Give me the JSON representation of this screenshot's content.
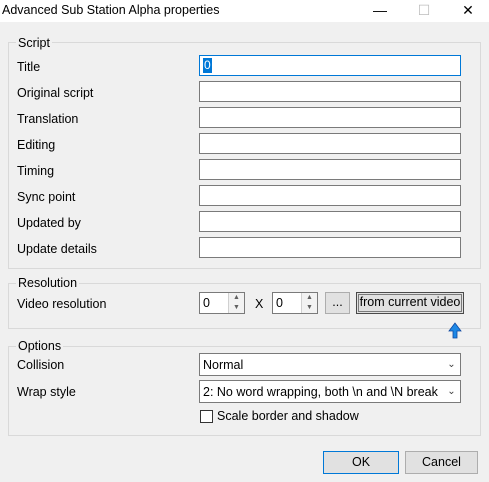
{
  "window": {
    "title": "Advanced Sub Station Alpha properties",
    "minimize_glyph": "—",
    "maximize_glyph": "☐",
    "close_glyph": "✕"
  },
  "script": {
    "legend": "Script",
    "fields": [
      {
        "label": "Title",
        "value": "0"
      },
      {
        "label": "Original script",
        "value": ""
      },
      {
        "label": "Translation",
        "value": ""
      },
      {
        "label": "Editing",
        "value": ""
      },
      {
        "label": "Timing",
        "value": ""
      },
      {
        "label": "Sync point",
        "value": ""
      },
      {
        "label": "Updated by",
        "value": ""
      },
      {
        "label": "Update details",
        "value": ""
      }
    ]
  },
  "resolution": {
    "legend": "Resolution",
    "label": "Video resolution",
    "width": "0",
    "separator": "X",
    "height": "0",
    "browse_label": "...",
    "from_video_label": "from current video"
  },
  "options": {
    "legend": "Options",
    "collision_label": "Collision",
    "collision_value": "Normal",
    "wrap_label": "Wrap style",
    "wrap_value": "2: No word wrapping, both \\n and \\N break",
    "scale_label": "Scale border and shadow",
    "scale_checked": false
  },
  "footer": {
    "ok_label": "OK",
    "cancel_label": "Cancel"
  },
  "colors": {
    "accent": "#0078d7",
    "background": "#f0f0f0"
  }
}
